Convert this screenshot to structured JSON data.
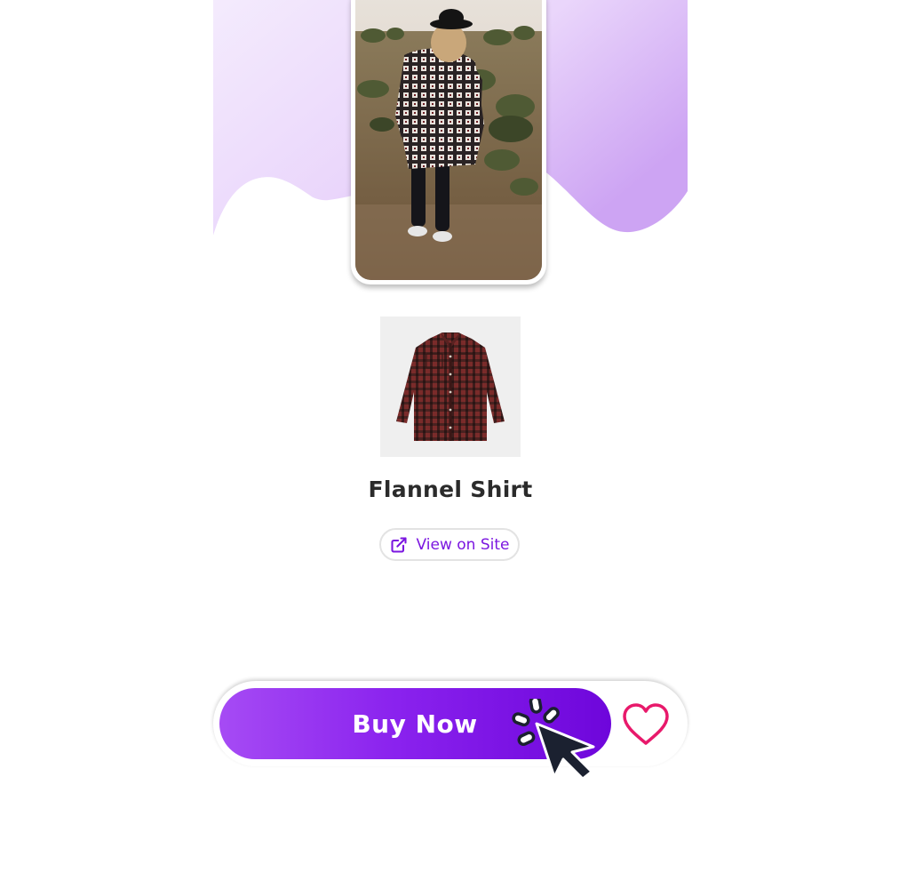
{
  "product": {
    "title": "Flannel Shirt",
    "view_site_label": "View on Site",
    "lifestyle_photo": "woman-in-plaid-shirt-photo",
    "thumbnail": "red-flannel-shirt-thumbnail"
  },
  "actions": {
    "buy_label": "Buy Now",
    "favorite_icon": "heart-icon",
    "cursor_icon": "click-cursor-icon"
  },
  "colors": {
    "accent": "#7b16e0",
    "gradient_start": "#a64bf4",
    "gradient_end": "#6e06db",
    "heart": "#e8196b",
    "hero_light": "#f3e7fd",
    "hero_dark": "#cfa6f4"
  }
}
